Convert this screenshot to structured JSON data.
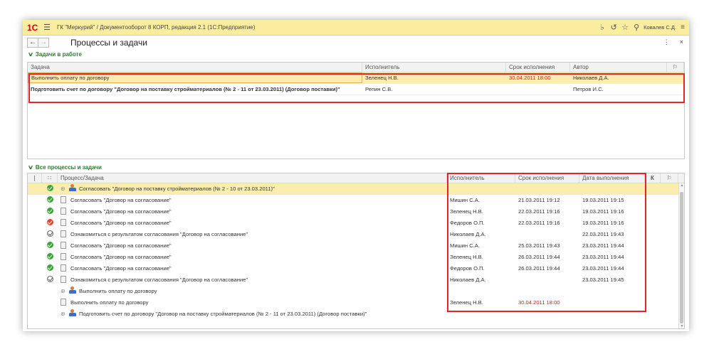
{
  "titlebar": {
    "logo": "1С",
    "title": "ГК \"Меркурий\" / Документооборот 8 КОРП, редакция 2.1  (1С:Предприятие)",
    "user": "Ковалев С.Д."
  },
  "header": {
    "title": "Процессы и задачи"
  },
  "tasks_section": {
    "title": "Задачи в работе",
    "columns": [
      "Задача",
      "Исполнитель",
      "Срок исполнения",
      "Автор"
    ],
    "rows": [
      {
        "task": "Выполнить оплату по договору",
        "performer": "Зеленец Н.В.",
        "deadline": "30.04.2011 18:00",
        "author": "Николаев Д.А."
      },
      {
        "task": "Подготовить счет по договору \"Договор на поставку стройматериалов (№ 2 - 11 от 23.03.2011) (Договор поставки)\"",
        "performer": "Репин С.В.",
        "deadline": "",
        "author": "Петров И.С."
      }
    ]
  },
  "processes_section": {
    "title": "Все процессы и задачи",
    "columns": [
      "Процесс/Задача",
      "Исполнитель",
      "Срок исполнения",
      "Дата выполнения",
      "К"
    ],
    "rows": [
      {
        "status": "ok",
        "type": "process",
        "name": "Согласовать \"Договор на поставку стройматериалов (№ 2 - 10 от 23.03.2011)\"",
        "performer": "",
        "deadline": "",
        "done": ""
      },
      {
        "status": "ok",
        "type": "task",
        "name": "Согласовать \"Договор на согласование\"",
        "performer": "Мишин С.А.",
        "deadline": "21.03.2011 19:12",
        "done": "19.03.2011 19:15"
      },
      {
        "status": "ok",
        "type": "task",
        "name": "Согласовать \"Договор на согласование\"",
        "performer": "Зеленец Н.В.",
        "deadline": "22.03.2011 19:16",
        "done": "19.03.2011 19:16"
      },
      {
        "status": "err",
        "type": "task",
        "name": "Согласовать \"Договор на согласование\"",
        "performer": "Федоров О.П.",
        "deadline": "22.03.2011 19:16",
        "done": "19.03.2011 19:16"
      },
      {
        "status": "info",
        "type": "task",
        "name": "Ознакомиться с результатом согласования \"Договор на согласование\"",
        "performer": "Николаев Д.А.",
        "deadline": "",
        "done": "22.03.2011 19:43"
      },
      {
        "status": "ok",
        "type": "task",
        "name": "Согласовать \"Договор на согласование\"",
        "performer": "Мишин С.А.",
        "deadline": "25.03.2011 19:43",
        "done": "23.03.2011 19:44"
      },
      {
        "status": "ok",
        "type": "task",
        "name": "Согласовать \"Договор на согласование\"",
        "performer": "Зеленец Н.В.",
        "deadline": "26.03.2011 19:44",
        "done": "23.03.2011 19:44"
      },
      {
        "status": "ok",
        "type": "task",
        "name": "Согласовать \"Договор на согласование\"",
        "performer": "Федоров О.П.",
        "deadline": "26.03.2011 19:44",
        "done": "23.03.2011 19:44"
      },
      {
        "status": "info",
        "type": "task",
        "name": "Ознакомиться с результатом согласования \"Договор на согласование\"",
        "performer": "Николаев Д.А.",
        "deadline": "",
        "done": "23.03.2011 19:45"
      },
      {
        "status": "",
        "type": "process",
        "name": "Выполнить оплату по договору",
        "performer": "",
        "deadline": "",
        "done": ""
      },
      {
        "status": "",
        "type": "task",
        "name": "Выполнить оплату по договору",
        "performer": "Зеленец Н.В.",
        "deadline": "30.04.2011 18:00",
        "done": ""
      },
      {
        "status": "",
        "type": "process",
        "name": "Подготовить счет по договору \"Договор на поставку стройматериалов (№ 2 - 11 от 23.03.2011) (Договор поставки)\"",
        "performer": "",
        "deadline": "",
        "done": ""
      }
    ]
  },
  "colors": {
    "titlebar": "#fbeda0",
    "selection": "#fbedb0",
    "section_title": "#2c7a2c",
    "overdue": "#d21a1a",
    "highlight_box": "#e4232a"
  }
}
